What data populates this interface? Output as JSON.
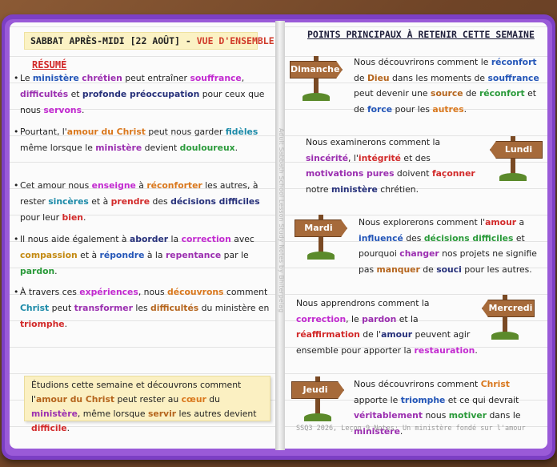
{
  "left_page": {
    "title_main": "SABBAT APRÈS-MIDI [22 AOÛT] - ",
    "title_accent": "VUE D'ENSEMBLE",
    "section_heading": "RÉSUMÉ",
    "bullets": [
      [
        "Le ",
        "ministère",
        " ",
        "chrétien",
        " peut entraîner ",
        "souffrance",
        ", ",
        "difficultés",
        " et ",
        "profonde préoccupation",
        " pour ceux que nous ",
        "servons",
        "."
      ],
      [
        "Pourtant, l'",
        "amour du Christ",
        " peut nous garder ",
        "fidèles",
        " même lorsque le ",
        "ministère",
        " devient ",
        "douloureux",
        "."
      ],
      [
        "Cet amour nous ",
        "enseigne",
        " à ",
        "réconforter",
        " les autres, à rester ",
        "sincères",
        " et à ",
        "prendre",
        " des ",
        "décisions difficiles",
        " pour leur ",
        "bien",
        "."
      ],
      [
        "Il nous aide également à ",
        "aborder",
        " la ",
        "correction",
        " avec ",
        "compassion",
        " et à ",
        "répondre",
        " à la ",
        "repentance",
        " par le ",
        "pardon",
        "."
      ],
      [
        "À travers ces ",
        "expériences",
        ", nous ",
        "découvrons",
        " comment ",
        "Christ",
        " peut ",
        "transformer",
        " les ",
        "difficultés",
        " du ministère en ",
        "triomphe",
        "."
      ]
    ],
    "note": [
      "Étudions cette semaine et découvrons comment l'",
      "amour du Christ",
      " peut rester au ",
      "cœur",
      " du ",
      "ministère",
      ", même lorsque ",
      "servir",
      " les autres devient ",
      "difficile",
      "."
    ]
  },
  "right_page": {
    "title": "POINTS PRINCIPAUX À RETENIR CETTE SEMAINE",
    "days": [
      {
        "name": "Dimanche",
        "text": [
          "Nous découvrirons comment le ",
          "réconfort",
          " de ",
          "Dieu",
          " dans les moments de ",
          "souffrance",
          " peut devenir une ",
          "source",
          " de ",
          "réconfort",
          " et de ",
          "force",
          " pour les ",
          "autres",
          "."
        ]
      },
      {
        "name": "Lundi",
        "text": [
          "Nous examinerons comment la ",
          "sincérité",
          ", l'",
          "intégrité",
          " et des ",
          "motivations pures",
          " doivent ",
          "façonner",
          " notre ",
          "ministère",
          " chrétien."
        ]
      },
      {
        "name": "Mardi",
        "text": [
          "Nous explorerons comment l'",
          "amour",
          " a ",
          "influencé",
          " des ",
          "décisions difficiles",
          " et pourquoi ",
          "changer",
          " nos projets ne signifie pas ",
          "manquer",
          " de ",
          "souci",
          " pour les autres."
        ]
      },
      {
        "name": "Mercredi",
        "text": [
          "Nous apprendrons comment la ",
          "correction",
          ", le ",
          "pardon",
          " et la ",
          "réaffirmation",
          " de l'",
          "amour",
          " peuvent agir ensemble pour apporter la ",
          "restauration",
          "."
        ]
      },
      {
        "name": "Jeudi",
        "text": [
          "Nous découvrirons comment ",
          "Christ",
          " apporte le ",
          "triomphe",
          " et ce qui devrait ",
          "véritablement",
          " nous ",
          "motiver",
          " dans le ",
          "ministère",
          "."
        ]
      }
    ],
    "footer": "SSQ3 2026, Leçon 9 Notes: Un ministère fondé sur l'amour"
  },
  "spine_text": "Adult Sabbath School Lesson Study Notes by Bhiterpelag",
  "colors": {
    "blue": "#2456b8",
    "purple": "#9b2fb0",
    "orange": "#d9771c",
    "red": "#d22a2a",
    "navy": "#26307a",
    "green": "#2a9a3a",
    "teal": "#1c8aa8",
    "brown": "#b5651d",
    "magenta": "#c22ad0",
    "gold": "#c48a12"
  },
  "icons": [
    "wooden-signpost-icon"
  ]
}
